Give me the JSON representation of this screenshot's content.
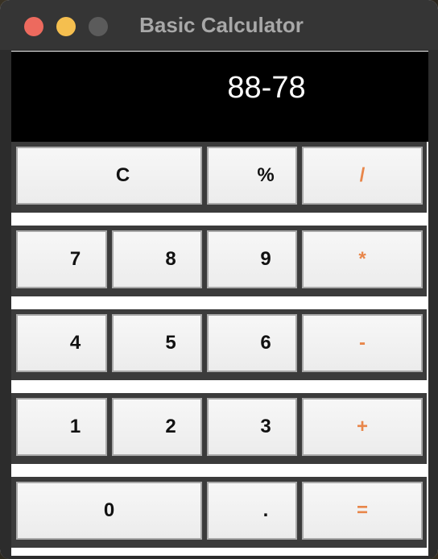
{
  "window": {
    "title": "Basic Calculator"
  },
  "display": {
    "value": "88-78"
  },
  "colors": {
    "operator": "#e8864a",
    "display_bg": "#000000",
    "titlebar": "#353535"
  },
  "keypad": {
    "rows": [
      [
        {
          "label": "C"
        },
        {
          "label": "%"
        },
        {
          "label": "/"
        }
      ],
      [
        {
          "label": "7"
        },
        {
          "label": "8"
        },
        {
          "label": "9"
        },
        {
          "label": "*"
        }
      ],
      [
        {
          "label": "4"
        },
        {
          "label": "5"
        },
        {
          "label": "6"
        },
        {
          "label": "-"
        }
      ],
      [
        {
          "label": "1"
        },
        {
          "label": "2"
        },
        {
          "label": "3"
        },
        {
          "label": "+"
        }
      ],
      [
        {
          "label": "0"
        },
        {
          "label": "."
        },
        {
          "label": "="
        }
      ]
    ]
  }
}
